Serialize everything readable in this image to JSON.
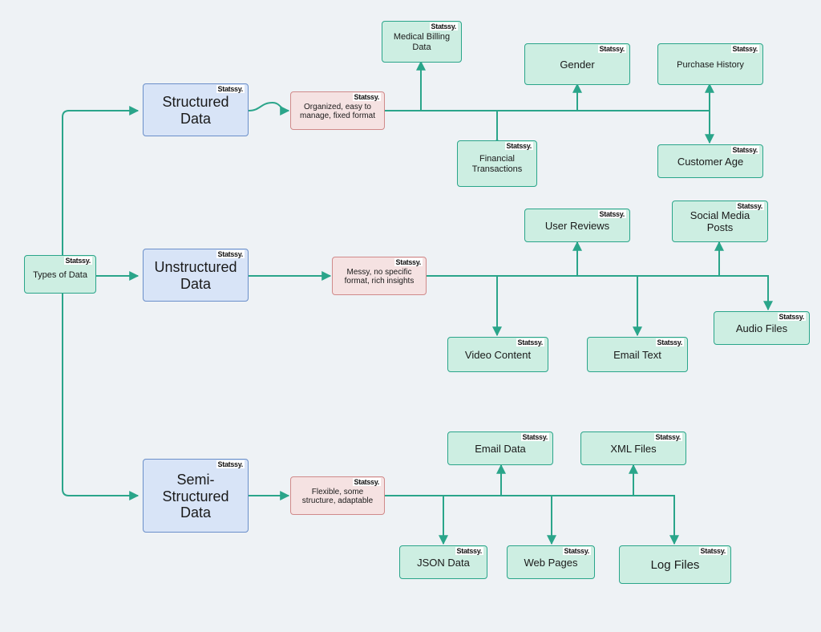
{
  "watermark": "Statssy.",
  "colors": {
    "green_fill": "#cdeee2",
    "green_stroke": "#2aa58a",
    "blue_fill": "#d8e4f7",
    "blue_stroke": "#6a8fc9",
    "red_fill": "#f5e2e2",
    "red_stroke": "#d08a8a",
    "arrow": "#2aa58a",
    "bg": "#eef2f5"
  },
  "root": {
    "label": "Types of Data"
  },
  "categories": {
    "structured": {
      "label": "Structured Data",
      "description": "Organized, easy to manage, fixed format"
    },
    "unstructured": {
      "label": "Unstructured Data",
      "description": "Messy, no specific format, rich insights"
    },
    "semi_structured": {
      "label": "Semi-Structured Data",
      "description": "Flexible, some structure, adaptable"
    }
  },
  "leaves": {
    "medical_billing": {
      "label": "Medical Billing Data"
    },
    "gender": {
      "label": "Gender"
    },
    "purchase_history": {
      "label": "Purchase History"
    },
    "financial_tx": {
      "label": "Financial Transactions"
    },
    "customer_age": {
      "label": "Customer Age"
    },
    "user_reviews": {
      "label": "User Reviews"
    },
    "social_media": {
      "label": "Social Media Posts"
    },
    "audio_files": {
      "label": "Audio Files"
    },
    "video_content": {
      "label": "Video Content"
    },
    "email_text": {
      "label": "Email Text"
    },
    "email_data": {
      "label": "Email Data"
    },
    "xml_files": {
      "label": "XML Files"
    },
    "json_data": {
      "label": "JSON Data"
    },
    "web_pages": {
      "label": "Web Pages"
    },
    "log_files": {
      "label": "Log Files"
    }
  }
}
